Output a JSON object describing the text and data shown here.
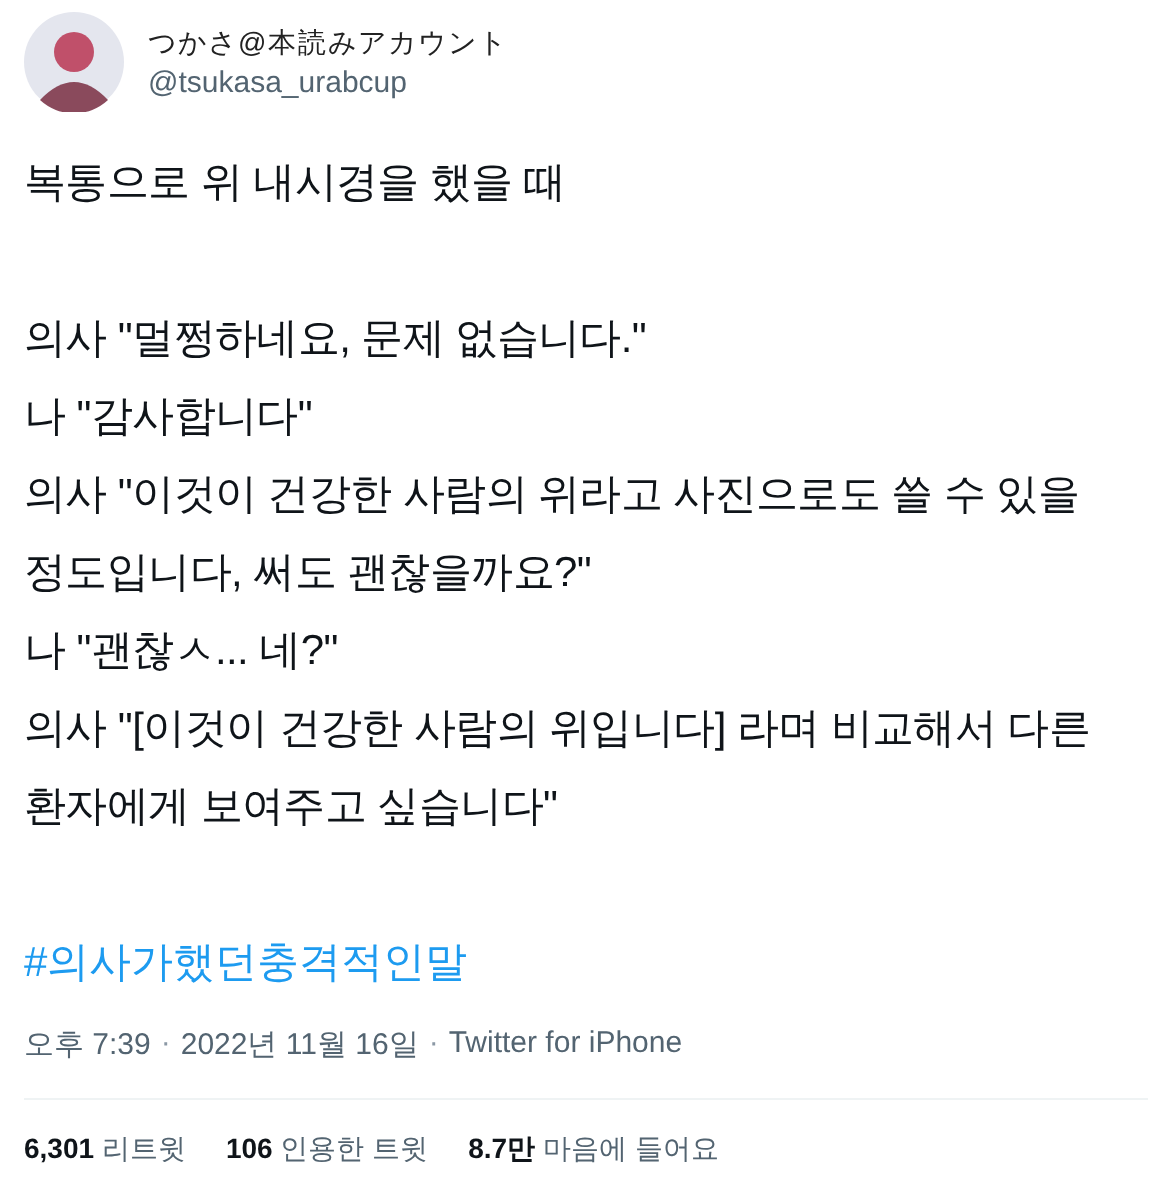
{
  "author": {
    "display_name": "つかさ@本読みアカウント",
    "handle": "@tsukasa_urabcup"
  },
  "body_paragraphs": [
    [
      "복통으로 위 내시경을 했을 때"
    ],
    [
      "의사 \"멀쩡하네요, 문제 없습니다.\"",
      "나 \"감사합니다\"",
      "의사 \"이것이 건강한 사람의 위라고 사진으로도 쓸 수 있을",
      "정도입니다, 써도 괜찮을까요?\"",
      "나 \"괜찮ㅅ... 네?\"",
      "의사 \"[이것이 건강한 사람의 위입니다] 라며 비교해서 다른",
      "환자에게 보여주고 싶습니다\""
    ]
  ],
  "hashtag": "#의사가했던충격적인말",
  "meta": [
    {
      "kind": "time",
      "text": "오후 7:39"
    },
    {
      "kind": "separator",
      "text": "·"
    },
    {
      "kind": "date",
      "text": "2022년 11월 16일"
    },
    {
      "kind": "separator",
      "text": "·"
    },
    {
      "kind": "source",
      "text": "Twitter for iPhone"
    }
  ],
  "stats": [
    {
      "count": "6,301",
      "label": "리트윗"
    },
    {
      "count": "106",
      "label": "인용한 트윗"
    },
    {
      "count": "8.7만",
      "label": "마음에 들어요"
    }
  ]
}
